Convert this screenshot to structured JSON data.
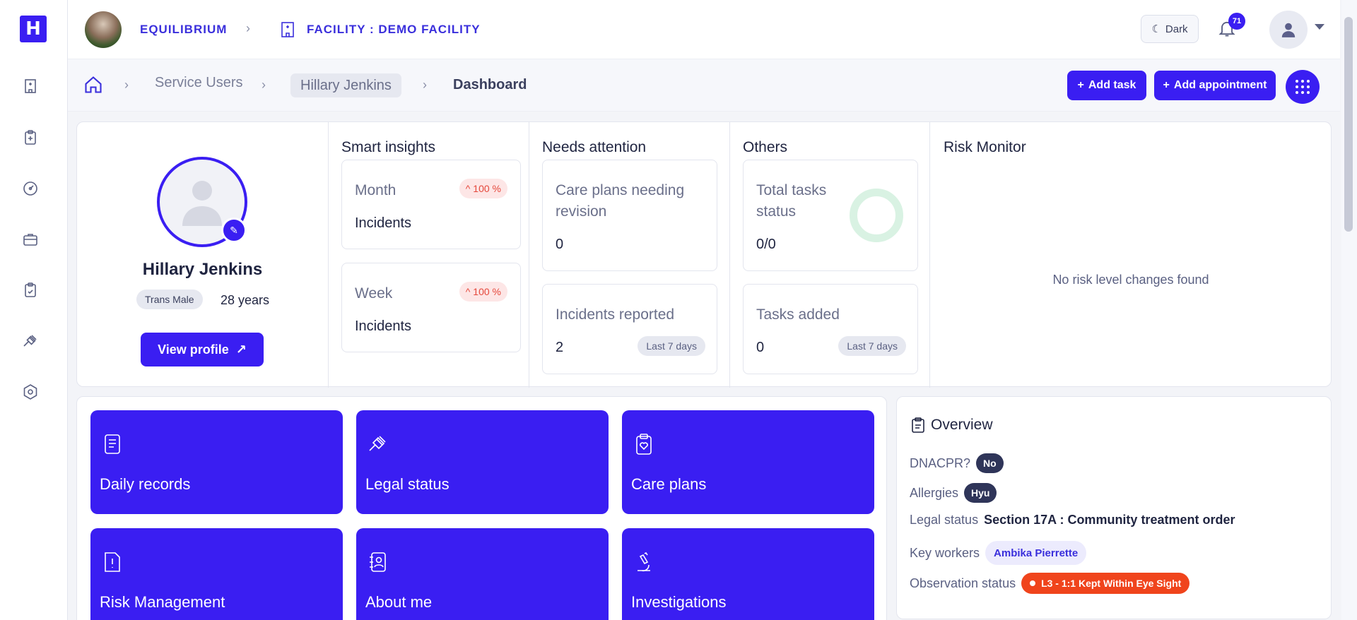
{
  "app": {
    "logo_text": "H"
  },
  "header": {
    "org_name": "EQUILIBRIUM",
    "facility_label": "FACILITY : DEMO FACILITY",
    "theme_toggle_label": "Dark",
    "notifications_count": "71"
  },
  "breadcrumb": {
    "items": [
      "Service Users",
      "Hillary Jenkins",
      "Dashboard"
    ]
  },
  "actions": {
    "add_task": "Add task",
    "add_appointment": "Add appointment"
  },
  "profile": {
    "name": "Hillary Jenkins",
    "gender": "Trans Male",
    "age": "28 years",
    "view_profile_label": "View profile"
  },
  "smart_insights": {
    "title": "Smart insights",
    "cards": [
      {
        "period": "Month",
        "metric": "Incidents",
        "trend": "100 %"
      },
      {
        "period": "Week",
        "metric": "Incidents",
        "trend": "100 %"
      }
    ]
  },
  "needs_attention": {
    "title": "Needs attention",
    "care_plans_label": "Care plans needing revision",
    "care_plans_value": "0",
    "incidents_label": "Incidents reported",
    "incidents_value": "2",
    "incidents_period": "Last 7 days"
  },
  "others": {
    "title": "Others",
    "total_tasks_label": "Total tasks status",
    "total_tasks_value": "0/0",
    "tasks_added_label": "Tasks added",
    "tasks_added_value": "0",
    "tasks_added_period": "Last 7 days"
  },
  "risk_monitor": {
    "title": "Risk Monitor",
    "empty_message": "No risk level changes found"
  },
  "tiles": [
    {
      "label": "Daily records",
      "icon": "document-icon"
    },
    {
      "label": "Legal status",
      "icon": "gavel-icon"
    },
    {
      "label": "Care plans",
      "icon": "clipboard-heart-icon"
    },
    {
      "label": "Risk Management",
      "icon": "alert-document-icon"
    },
    {
      "label": "About me",
      "icon": "contact-book-icon"
    },
    {
      "label": "Investigations",
      "icon": "microscope-icon"
    }
  ],
  "overview": {
    "title": "Overview",
    "dnacpr_label": "DNACPR?",
    "dnacpr_value": "No",
    "allergies_label": "Allergies",
    "allergies_value": "Hyu",
    "legal_status_label": "Legal status",
    "legal_status_value": "Section 17A : Community treatment order",
    "key_workers_label": "Key workers",
    "key_workers_value": "Ambika Pierrette",
    "observation_label": "Observation status",
    "observation_value": "L3 - 1:1 Kept Within Eye Sight"
  },
  "colors": {
    "primary": "#3a1ef2",
    "trend_up": "#e5483c",
    "observation": "#f0441c",
    "donut_empty": "#d9f2e3"
  }
}
